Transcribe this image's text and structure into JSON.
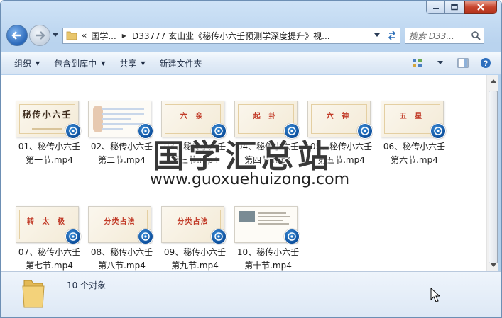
{
  "window": {
    "caption_buttons": [
      "minimize",
      "maximize",
      "close"
    ]
  },
  "navigation": {
    "breadcrumb_prefix": "«",
    "crumbs": [
      "国学...",
      "D33777 玄山业《秘传小六壬预测学深度提升》视..."
    ],
    "search_placeholder": "搜索 D33..."
  },
  "toolbar": {
    "organize": "组织",
    "include_library": "包含到库中",
    "share": "共享",
    "new_folder": "新建文件夹"
  },
  "files": [
    {
      "line1": "01、秘传小六壬",
      "line2": "第一节.mp4",
      "thumb_title": "秘传小六壬",
      "style": "big"
    },
    {
      "line1": "02、秘传小六壬",
      "line2": "第二节.mp4",
      "thumb_title": "",
      "style": "doc"
    },
    {
      "line1": "03、秘传小六壬",
      "line2": "第三节.mp4",
      "thumb_title": "六 亲",
      "style": "title"
    },
    {
      "line1": "04、秘传小六壬",
      "line2": "第四节.mp4",
      "thumb_title": "起 卦",
      "style": "title"
    },
    {
      "line1": "05、秘传小六壬",
      "line2": "第五节.mp4",
      "thumb_title": "六 神",
      "style": "title"
    },
    {
      "line1": "06、秘传小六壬",
      "line2": "第六节.mp4",
      "thumb_title": "五 星",
      "style": "title"
    },
    {
      "line1": "07、秘传小六壬",
      "line2": "第七节.mp4",
      "thumb_title": "转 太 极",
      "style": "title"
    },
    {
      "line1": "08、秘传小六壬",
      "line2": "第八节.mp4",
      "thumb_title": "分类占法",
      "style": "title"
    },
    {
      "line1": "09、秘传小六壬",
      "line2": "第九节.mp4",
      "thumb_title": "分类占法",
      "style": "title"
    },
    {
      "line1": "10、秘传小六壬",
      "line2": "第十节.mp4",
      "thumb_title": "",
      "style": "pic"
    }
  ],
  "watermark": {
    "title": "国学汇总站",
    "url": "www.guoxuehuizong.com"
  },
  "status": {
    "count_text": "10 个对象"
  }
}
